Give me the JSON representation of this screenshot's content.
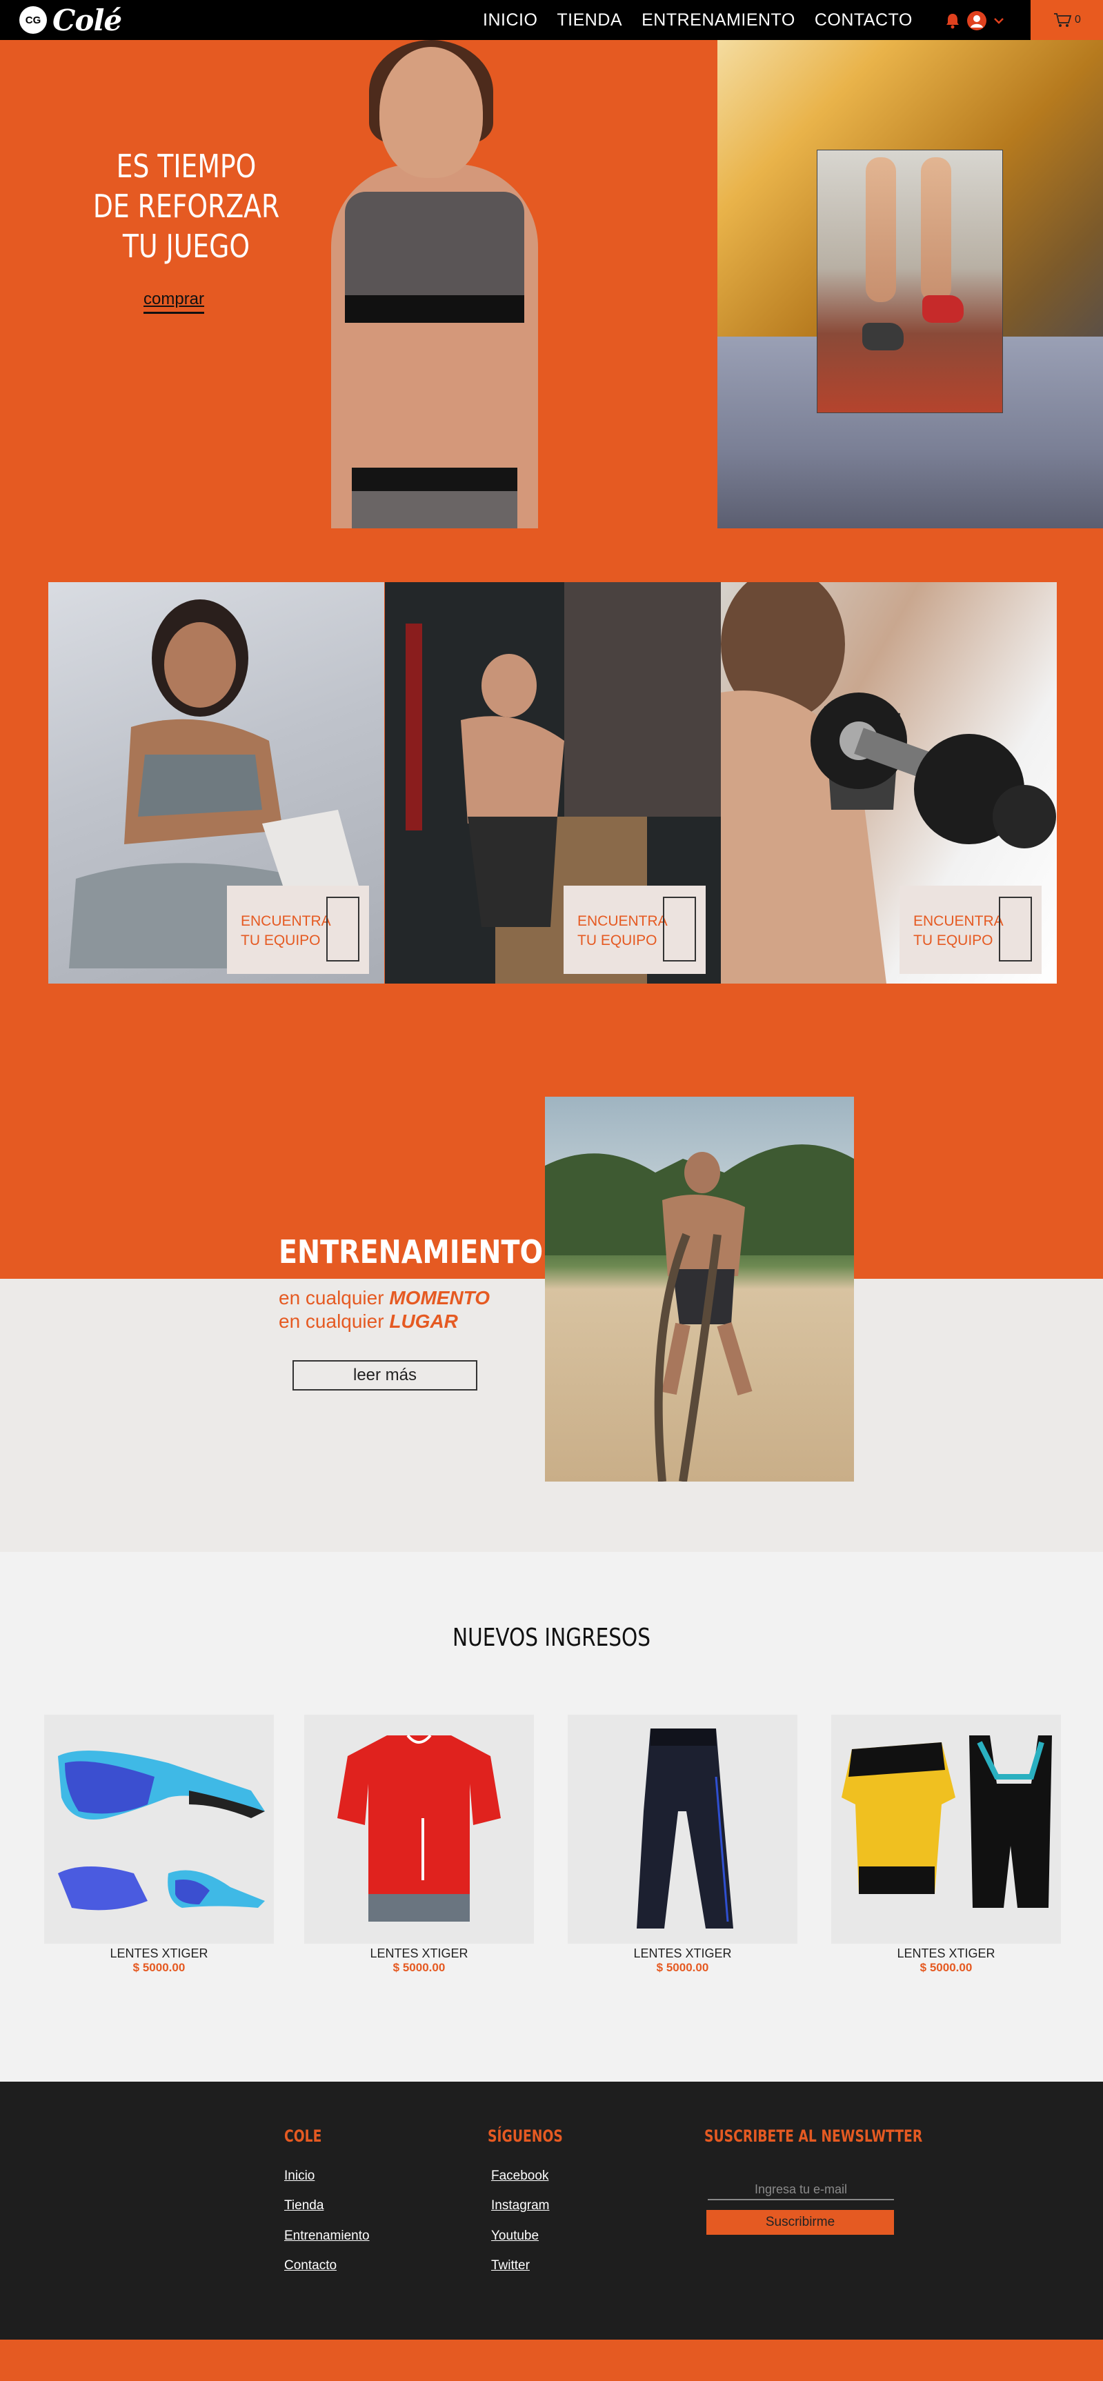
{
  "header": {
    "logo_badge": "CG",
    "logo_word": "Colé",
    "nav": [
      "INICIO",
      "TIENDA",
      "ENTRENAMIENTO",
      "CONTACTO"
    ],
    "cart_count": "0"
  },
  "hero": {
    "title_lines": [
      "ES TIEMPO",
      "DE REFORZAR",
      "TU JUEGO"
    ],
    "button": "comprar"
  },
  "categories": [
    {
      "label_lines": [
        "ENCUENTRA",
        "TU EQUIPO"
      ]
    },
    {
      "label_lines": [
        "ENCUENTRA",
        "TU EQUIPO"
      ]
    },
    {
      "label_lines": [
        "ENCUENTRA",
        "TU EQUIPO"
      ]
    }
  ],
  "training": {
    "title": "ENTRENAMIENTO",
    "line1_prefix": "en cualquier ",
    "line1_emph": "MOMENTO",
    "line2_prefix": "en cualquier ",
    "line2_emph": "LUGAR",
    "button": "leer más"
  },
  "new_arrivals": {
    "title": "NUEVOS INGRESOS",
    "products": [
      {
        "name": "LENTES XTIGER",
        "price": "$ 5000.00",
        "icon": "sunglasses-icon"
      },
      {
        "name": "LENTES XTIGER",
        "price": "$ 5000.00",
        "icon": "cycling-jersey-icon"
      },
      {
        "name": "LENTES XTIGER",
        "price": "$ 5000.00",
        "icon": "tights-icon"
      },
      {
        "name": "LENTES XTIGER",
        "price": "$ 5000.00",
        "icon": "jersey-kit-icon"
      }
    ]
  },
  "footer": {
    "col1": {
      "title": "COLE",
      "links": [
        "Inicio",
        "Tienda",
        "Entrenamiento",
        "Contacto"
      ]
    },
    "col2": {
      "title": "SÍGUENOS",
      "links": [
        "Facebook",
        "Instagram",
        "Youtube",
        "Twitter"
      ]
    },
    "col3": {
      "title": "SUSCRIBETE AL NEWSLWTTER",
      "placeholder": "Ingresa tu e-mail",
      "button": "Suscribirme"
    }
  },
  "colors": {
    "accent": "#e55a22",
    "dark": "#1e1e1e",
    "light": "#f2f2f2"
  }
}
